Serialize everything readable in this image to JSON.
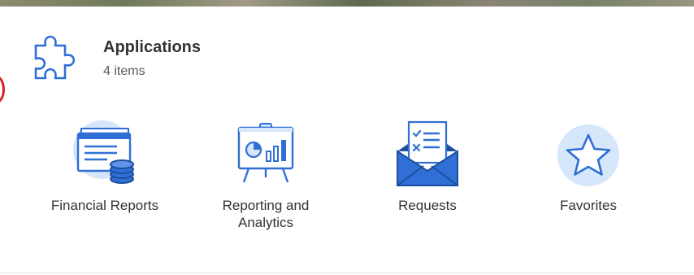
{
  "section": {
    "title": "Applications",
    "count": "4 items",
    "icon": "puzzle-piece-icon"
  },
  "apps": [
    {
      "label": "Financial Reports",
      "icon": "financial-reports-icon"
    },
    {
      "label": "Reporting and Analytics",
      "icon": "reporting-analytics-icon"
    },
    {
      "label": "Requests",
      "icon": "requests-envelope-icon"
    },
    {
      "label": "Favorites",
      "icon": "favorites-star-icon"
    }
  ],
  "colors": {
    "accent": "#2f6fd6",
    "icon_light": "#d6e6fb",
    "title_text": "#333333",
    "count_text": "#595959",
    "marker": "#d8201e"
  }
}
